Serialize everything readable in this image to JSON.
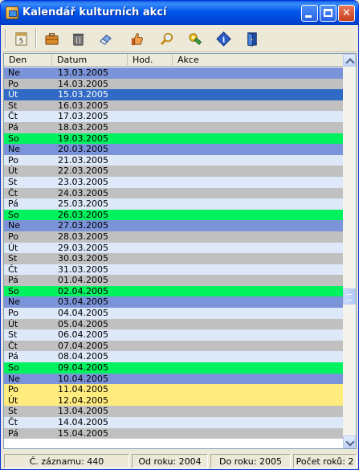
{
  "window": {
    "title": "Kalendář kulturních akcí",
    "colors": {
      "title_bar": "#0054e3",
      "close_button": "#d9532c"
    }
  },
  "toolbar": {
    "items": [
      {
        "name": "calendar-icon"
      },
      {
        "name": "briefcase-icon"
      },
      {
        "name": "trash-icon"
      },
      {
        "name": "eraser-icon"
      },
      {
        "name": "thumbs-up-icon"
      },
      {
        "name": "magnifier-icon"
      },
      {
        "name": "tools-icon"
      },
      {
        "name": "info-icon"
      },
      {
        "name": "exit-door-icon"
      }
    ]
  },
  "list": {
    "columns": [
      "Den",
      "Datum",
      "Hod.",
      "Akce"
    ],
    "row_colors": {
      "weekday_a": "#dde8f9",
      "weekday_b": "#c0c0c0",
      "saturday": "#00f25f",
      "sunday": "#7b93d9",
      "selected": "#316ac5",
      "highlight": "#ffeb7e"
    },
    "rows": [
      {
        "day": "Ne",
        "date": "13.03.2005",
        "color": "sunday"
      },
      {
        "day": "Po",
        "date": "14.03.2005",
        "color": "weekday_b"
      },
      {
        "day": "Út",
        "date": "15.03.2005",
        "color": "selected"
      },
      {
        "day": "St",
        "date": "16.03.2005",
        "color": "weekday_b"
      },
      {
        "day": "Čt",
        "date": "17.03.2005",
        "color": "weekday_a"
      },
      {
        "day": "Pá",
        "date": "18.03.2005",
        "color": "weekday_b"
      },
      {
        "day": "So",
        "date": "19.03.2005",
        "color": "saturday"
      },
      {
        "day": "Ne",
        "date": "20.03.2005",
        "color": "sunday"
      },
      {
        "day": "Po",
        "date": "21.03.2005",
        "color": "weekday_a"
      },
      {
        "day": "Út",
        "date": "22.03.2005",
        "color": "weekday_b"
      },
      {
        "day": "St",
        "date": "23.03.2005",
        "color": "weekday_a"
      },
      {
        "day": "Čt",
        "date": "24.03.2005",
        "color": "weekday_b"
      },
      {
        "day": "Pá",
        "date": "25.03.2005",
        "color": "weekday_a"
      },
      {
        "day": "So",
        "date": "26.03.2005",
        "color": "saturday"
      },
      {
        "day": "Ne",
        "date": "27.03.2005",
        "color": "sunday"
      },
      {
        "day": "Po",
        "date": "28.03.2005",
        "color": "weekday_b"
      },
      {
        "day": "Út",
        "date": "29.03.2005",
        "color": "weekday_a"
      },
      {
        "day": "St",
        "date": "30.03.2005",
        "color": "weekday_b"
      },
      {
        "day": "Čt",
        "date": "31.03.2005",
        "color": "weekday_a"
      },
      {
        "day": "Pá",
        "date": "01.04.2005",
        "color": "weekday_b"
      },
      {
        "day": "So",
        "date": "02.04.2005",
        "color": "saturday"
      },
      {
        "day": "Ne",
        "date": "03.04.2005",
        "color": "sunday"
      },
      {
        "day": "Po",
        "date": "04.04.2005",
        "color": "weekday_a"
      },
      {
        "day": "Út",
        "date": "05.04.2005",
        "color": "weekday_b"
      },
      {
        "day": "St",
        "date": "06.04.2005",
        "color": "weekday_a"
      },
      {
        "day": "Čt",
        "date": "07.04.2005",
        "color": "weekday_b"
      },
      {
        "day": "Pá",
        "date": "08.04.2005",
        "color": "weekday_a"
      },
      {
        "day": "So",
        "date": "09.04.2005",
        "color": "saturday"
      },
      {
        "day": "Ne",
        "date": "10.04.2005",
        "color": "sunday"
      },
      {
        "day": "Po",
        "date": "11.04.2005",
        "color": "highlight"
      },
      {
        "day": "Út",
        "date": "12.04.2005",
        "color": "highlight"
      },
      {
        "day": "St",
        "date": "13.04.2005",
        "color": "weekday_b"
      },
      {
        "day": "Čt",
        "date": "14.04.2005",
        "color": "weekday_a"
      },
      {
        "day": "Pá",
        "date": "15.04.2005",
        "color": "weekday_b"
      }
    ]
  },
  "status": {
    "record": "Č. záznamu: 440",
    "from_year": "Od roku: 2004",
    "to_year": "Do roku: 2005",
    "year_count": "Počet roků: 2"
  }
}
